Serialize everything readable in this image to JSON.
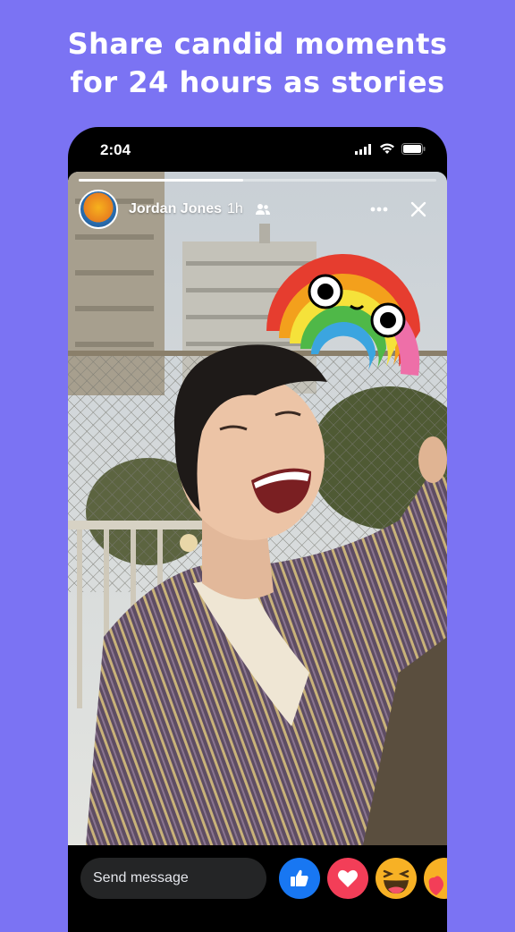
{
  "headline": {
    "line1": "Share candid moments",
    "line2": "for 24 hours as stories"
  },
  "status_bar": {
    "time": "2:04",
    "icons": [
      "cellular-signal-icon",
      "wifi-icon",
      "battery-icon"
    ]
  },
  "story": {
    "progress": 0.46,
    "user": {
      "name": "Jordan Jones",
      "time_ago": "1h",
      "audience_icon": "friends-icon"
    },
    "actions": [
      "more-options-icon",
      "close-icon"
    ],
    "sticker": "rainbow-sticker"
  },
  "composer": {
    "placeholder": "Send message"
  },
  "reactions": [
    "like",
    "love",
    "haha",
    "care"
  ],
  "colors": {
    "background": "#7b73f3",
    "like": "#1877f2",
    "love": "#f33e58",
    "haha": "#f7b125"
  }
}
